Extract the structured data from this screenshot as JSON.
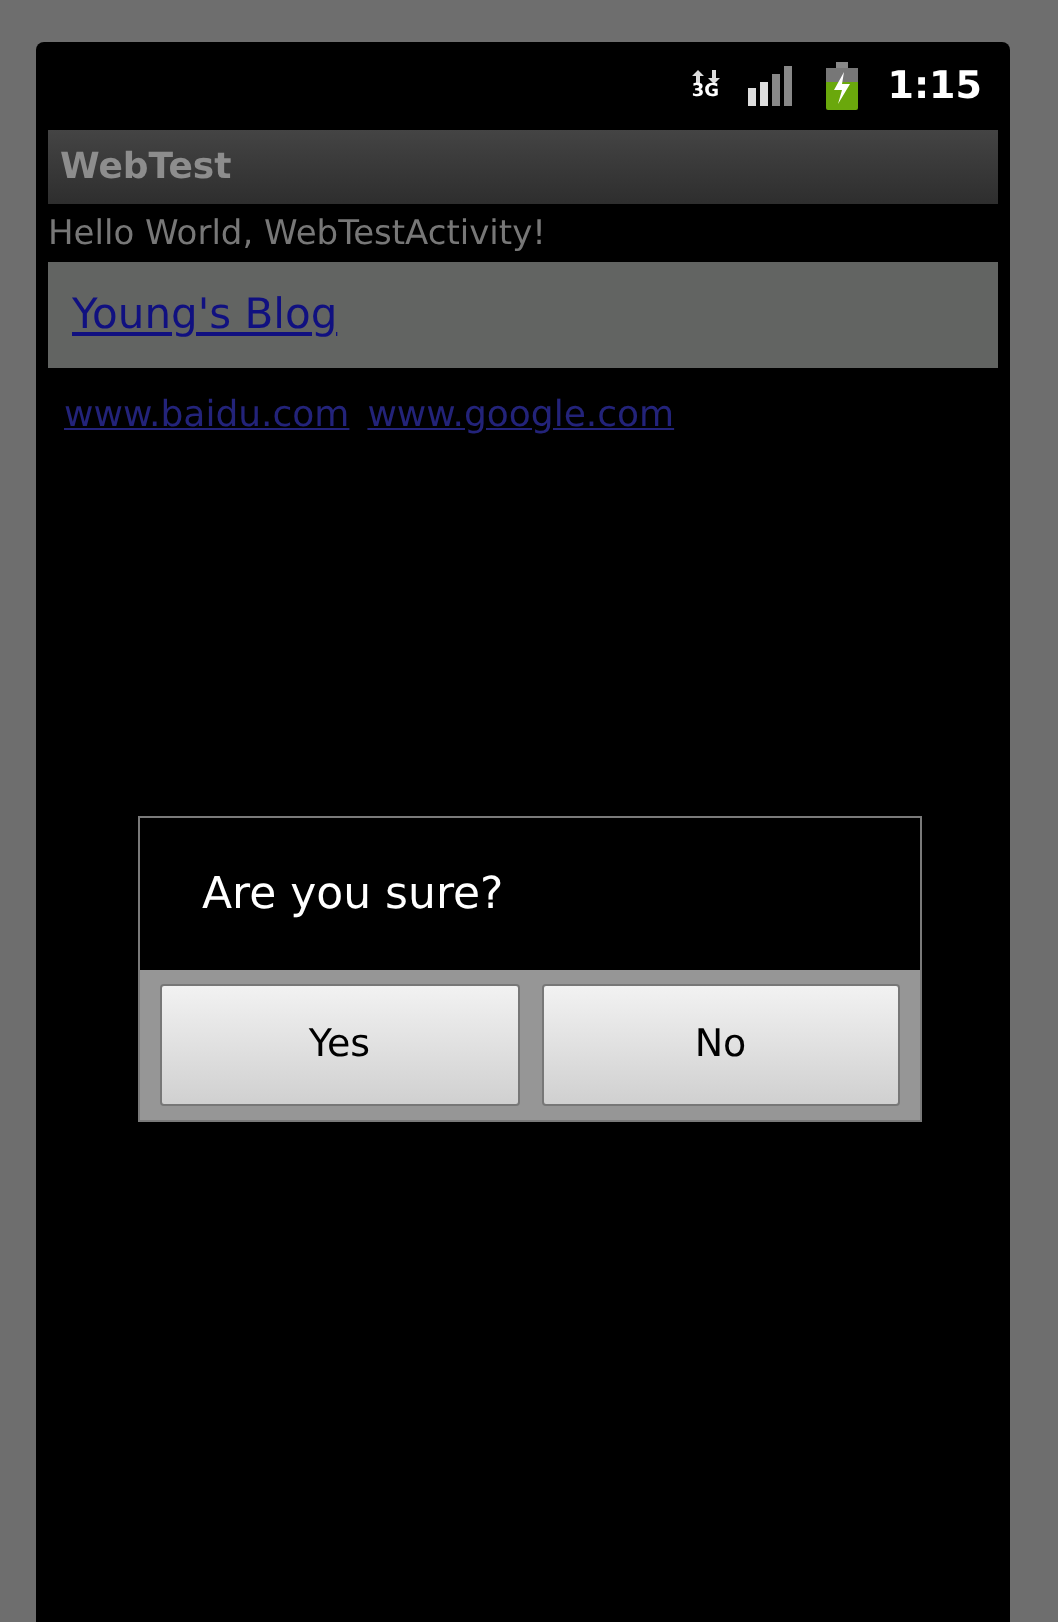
{
  "status_bar": {
    "network": "3G",
    "time": "1:15"
  },
  "title_bar": {
    "title": "WebTest"
  },
  "greeting": "Hello World, WebTestActivity!",
  "blog_link": "Young's Blog",
  "links": [
    "www.baidu.com",
    "www.google.com"
  ],
  "dialog": {
    "message": "Are you sure?",
    "buttons": [
      "Yes",
      "No"
    ]
  }
}
